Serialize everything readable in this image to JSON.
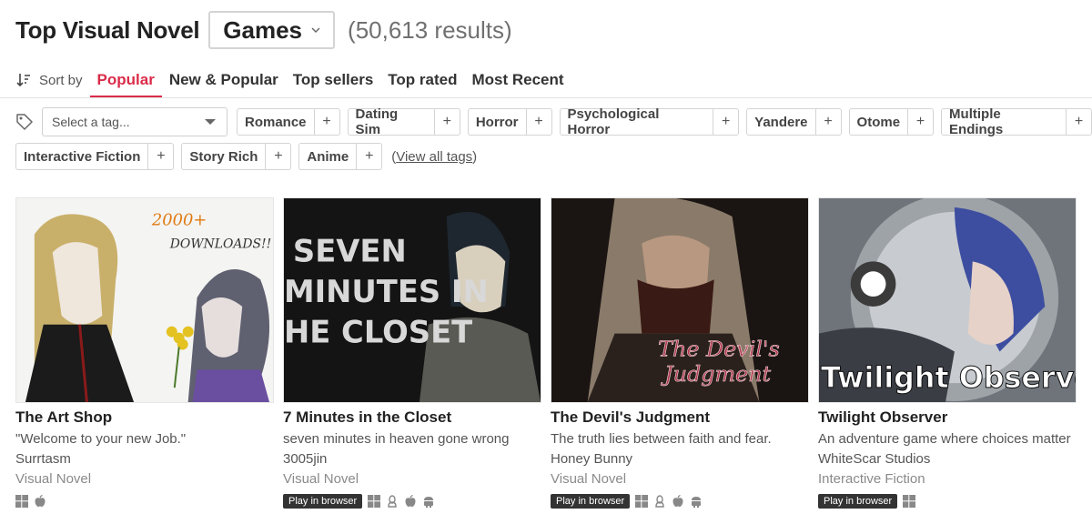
{
  "header": {
    "title": "Top Visual Novel",
    "type_selected": "Games",
    "results": "(50,613 results)"
  },
  "sort": {
    "label": "Sort by",
    "tabs": [
      {
        "label": "Popular",
        "active": true
      },
      {
        "label": "New & Popular",
        "active": false
      },
      {
        "label": "Top sellers",
        "active": false
      },
      {
        "label": "Top rated",
        "active": false
      },
      {
        "label": "Most Recent",
        "active": false
      }
    ]
  },
  "tags": {
    "select_placeholder": "Select a tag...",
    "add_symbol": "+",
    "items": [
      "Romance",
      "Dating Sim",
      "Horror",
      "Psychological Horror",
      "Yandere",
      "Otome",
      "Multiple Endings",
      "Interactive Fiction",
      "Story Rich",
      "Anime"
    ],
    "view_all": "View all tags"
  },
  "games": [
    {
      "title": "The Art Shop",
      "description": "\"Welcome to your new Job.\"",
      "author": "Surrtasm",
      "genre": "Visual Novel",
      "platforms": [
        "windows-icon",
        "apple-icon"
      ],
      "browser": ""
    },
    {
      "title": "7 Minutes in the Closet",
      "description": "seven minutes in heaven gone wrong",
      "author": "3005jin",
      "genre": "Visual Novel",
      "platforms": [
        "windows-icon",
        "linux-icon",
        "apple-icon",
        "android-icon"
      ],
      "browser": "Play in browser",
      "cover_text": [
        "SEVEN",
        "MINUTES IN",
        "HE CLOSET"
      ]
    },
    {
      "title": "The Devil's Judgment",
      "description": "The truth lies between faith and fear.",
      "author": "Honey Bunny",
      "genre": "Visual Novel",
      "platforms": [
        "windows-icon",
        "linux-icon",
        "apple-icon",
        "android-icon"
      ],
      "browser": "Play in browser",
      "cover_text": [
        "The Devil's",
        "Judgment"
      ]
    },
    {
      "title": "Twilight Observer",
      "description": "An adventure game where choices matter",
      "author": "WhiteScar Studios",
      "genre": "Interactive Fiction",
      "platforms": [
        "windows-icon"
      ],
      "browser": "Play in browser",
      "cover_text": [
        "Twilight Observer"
      ]
    }
  ],
  "cover_art_text": {
    "art_shop": [
      "2000+",
      "DOWNLOADS!!"
    ]
  },
  "colors": {
    "accent": "#da2c49",
    "badge_bg": "#333333"
  }
}
